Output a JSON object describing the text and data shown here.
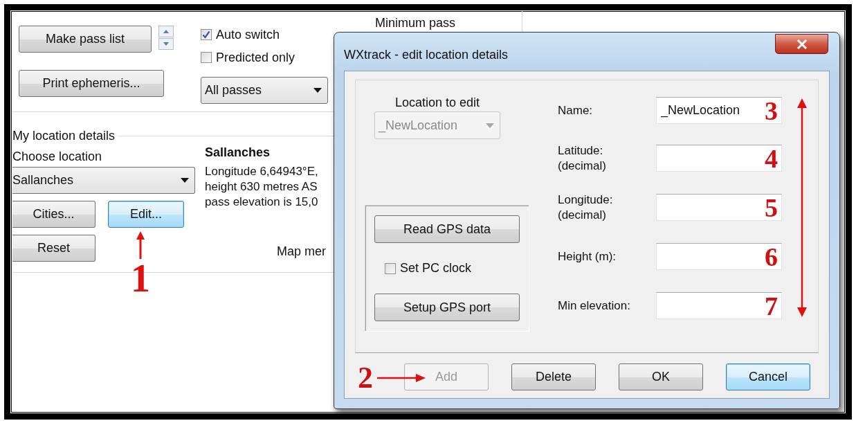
{
  "main_window": {
    "pass_buttons": [
      {
        "label": "Make pass list",
        "spinner": true
      },
      {
        "label": "Print ephemeris...",
        "spinner": false
      }
    ],
    "checkboxes": [
      {
        "label": "Auto switch",
        "checked": true
      },
      {
        "label": "Predicted only",
        "checked": false
      }
    ],
    "pass_filter": "All passes",
    "minimum_pass_label": "Minimum pass",
    "location_group": {
      "title": "My location details",
      "choose_label": "Choose location",
      "location": "Sallanches",
      "buttons": [
        {
          "label": "Cities...",
          "focused": false
        },
        {
          "label": "Edit...",
          "focused": true
        },
        {
          "label": "Reset",
          "focused": false
        }
      ],
      "place_name": "Sallanches",
      "details": [
        "Longitude 6,64943°E,",
        "height 630 metres AS",
        "pass elevation is 15,0"
      ],
      "map_label": "Map mer"
    },
    "annotation": "1"
  },
  "dialog": {
    "title": "WXtrack - edit location details",
    "location_to_edit": {
      "label": "Location to edit",
      "value": "_NewLocation",
      "disabled": true
    },
    "gps_buttons": [
      "Read GPS data",
      "Setup GPS port"
    ],
    "set_pc_clock": {
      "label": "Set PC clock",
      "checked": false
    },
    "fields": [
      {
        "label": "Name:",
        "value": "_NewLocation",
        "marker": "3"
      },
      {
        "label": "Latitude:\n(decimal)",
        "marker": "4"
      },
      {
        "label": "Longitude:\n(decimal)",
        "marker": "5"
      },
      {
        "label": "Height (m):",
        "marker": "6"
      },
      {
        "label": "Min elevation:",
        "marker": "7"
      }
    ],
    "buttons": [
      {
        "label": "Add",
        "disabled": true,
        "focused": false
      },
      {
        "label": "Delete",
        "disabled": false,
        "focused": false
      },
      {
        "label": "OK",
        "disabled": false,
        "focused": false
      },
      {
        "label": "Cancel",
        "disabled": false,
        "focused": true
      }
    ],
    "annotation": "2"
  }
}
